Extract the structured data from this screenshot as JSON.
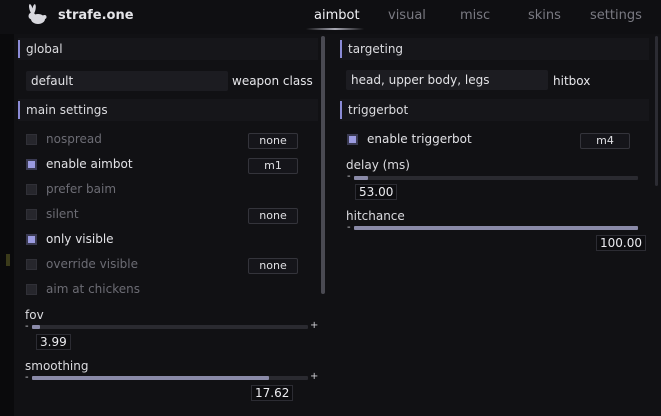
{
  "app": {
    "brand": "strafe.one",
    "logo_icon": "rabbit-icon",
    "accent": "#8b8bd6"
  },
  "tabs": [
    {
      "label": "aimbot",
      "active": true
    },
    {
      "label": "visual",
      "active": false
    },
    {
      "label": "misc",
      "active": false
    },
    {
      "label": "skins",
      "active": false
    },
    {
      "label": "settings",
      "active": false
    }
  ],
  "left": {
    "global": {
      "title": "global",
      "weapon_class": {
        "value": "default",
        "label": "weapon class"
      }
    },
    "main_settings": {
      "title": "main settings",
      "checkboxes": [
        {
          "label": "nospread",
          "checked": false,
          "enabled": false,
          "key": "none"
        },
        {
          "label": "enable aimbot",
          "checked": true,
          "enabled": true,
          "key": "m1"
        },
        {
          "label": "prefer baim",
          "checked": false,
          "enabled": false,
          "key": ""
        },
        {
          "label": "silent",
          "checked": false,
          "enabled": false,
          "key": "none"
        },
        {
          "label": "only visible",
          "checked": true,
          "enabled": true,
          "key": ""
        },
        {
          "label": "override visible",
          "checked": false,
          "enabled": false,
          "key": "none"
        },
        {
          "label": "aim at chickens",
          "checked": false,
          "enabled": false,
          "key": ""
        }
      ],
      "sliders": [
        {
          "label": "fov",
          "value": "3.99",
          "fraction": 0.03
        },
        {
          "label": "smoothing",
          "value": "17.62",
          "fraction": 0.86
        }
      ]
    }
  },
  "right": {
    "targeting": {
      "title": "targeting",
      "hitbox": {
        "value": "head, upper body, legs",
        "label": "hitbox"
      }
    },
    "triggerbot": {
      "title": "triggerbot",
      "enable": {
        "label": "enable triggerbot",
        "checked": true,
        "key": "m4"
      },
      "sliders": [
        {
          "label": "delay (ms)",
          "value": "53.00",
          "fraction": 0.05
        },
        {
          "label": "hitchance",
          "value": "100.00",
          "fraction": 1.0
        }
      ]
    }
  },
  "slider_symbols": {
    "minus": "-",
    "plus": "+"
  }
}
